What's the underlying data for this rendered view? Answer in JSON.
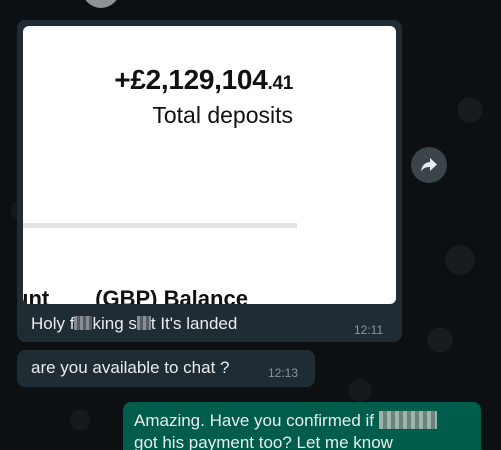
{
  "messages": {
    "image_message": {
      "amount_main": "+£2,129,104",
      "amount_cents": ".41",
      "amount_label": "Total deposits",
      "partial_col_a": "unt",
      "partial_col_b": "(GBP) Balance",
      "caption_part1": "Holy f",
      "caption_part2": "king s",
      "caption_part3": "t It's landed",
      "time": "12:11"
    },
    "incoming_text": {
      "text": "are you available to chat ?",
      "time": "12:13"
    },
    "outgoing_text": {
      "line1": "Amazing. Have you confirmed if",
      "line2": "got his payment too? Let me know"
    }
  },
  "icons": {
    "forward": "forward-arrow-icon",
    "avatar": "contact-avatar"
  },
  "colors": {
    "background": "#0c1013",
    "incoming_bubble": "#202c33",
    "outgoing_bubble": "#005c4b",
    "timestamp": "#8696a0"
  }
}
